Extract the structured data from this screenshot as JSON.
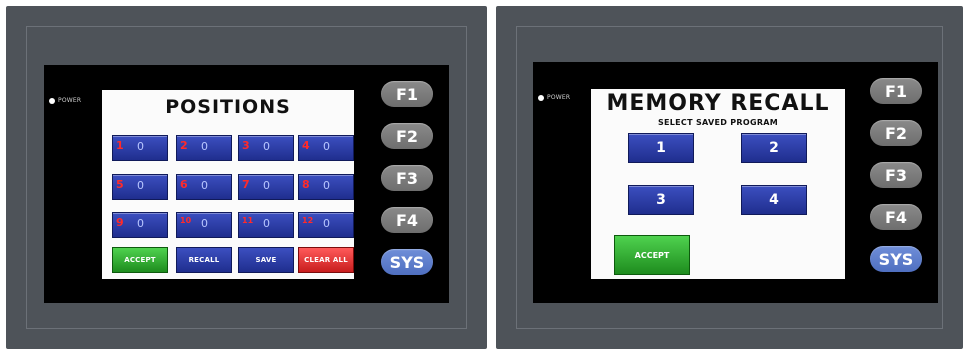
{
  "positions_panel": {
    "power_label": "POWER",
    "title": "POSITIONS",
    "buttons": [
      {
        "num": "1",
        "value": "0"
      },
      {
        "num": "2",
        "value": "0"
      },
      {
        "num": "3",
        "value": "0"
      },
      {
        "num": "4",
        "value": "0"
      },
      {
        "num": "5",
        "value": "0"
      },
      {
        "num": "6",
        "value": "0"
      },
      {
        "num": "7",
        "value": "0"
      },
      {
        "num": "8",
        "value": "0"
      },
      {
        "num": "9",
        "value": "0"
      },
      {
        "num": "10",
        "value": "0"
      },
      {
        "num": "11",
        "value": "0"
      },
      {
        "num": "12",
        "value": "0"
      }
    ],
    "actions": {
      "accept": "ACCEPT",
      "recall": "RECALL",
      "save": "SAVE",
      "clear_all": "CLEAR ALL"
    },
    "fkeys": {
      "f1": "F1",
      "f2": "F2",
      "f3": "F3",
      "f4": "F4",
      "sys": "SYS"
    }
  },
  "memory_panel": {
    "power_label": "POWER",
    "title": "MEMORY RECALL",
    "subtitle": "SELECT SAVED PROGRAM",
    "programs": {
      "p1": "1",
      "p2": "2",
      "p3": "3",
      "p4": "4"
    },
    "accept": "ACCEPT",
    "fkeys": {
      "f1": "F1",
      "f2": "F2",
      "f3": "F3",
      "f4": "F4",
      "sys": "SYS"
    }
  }
}
